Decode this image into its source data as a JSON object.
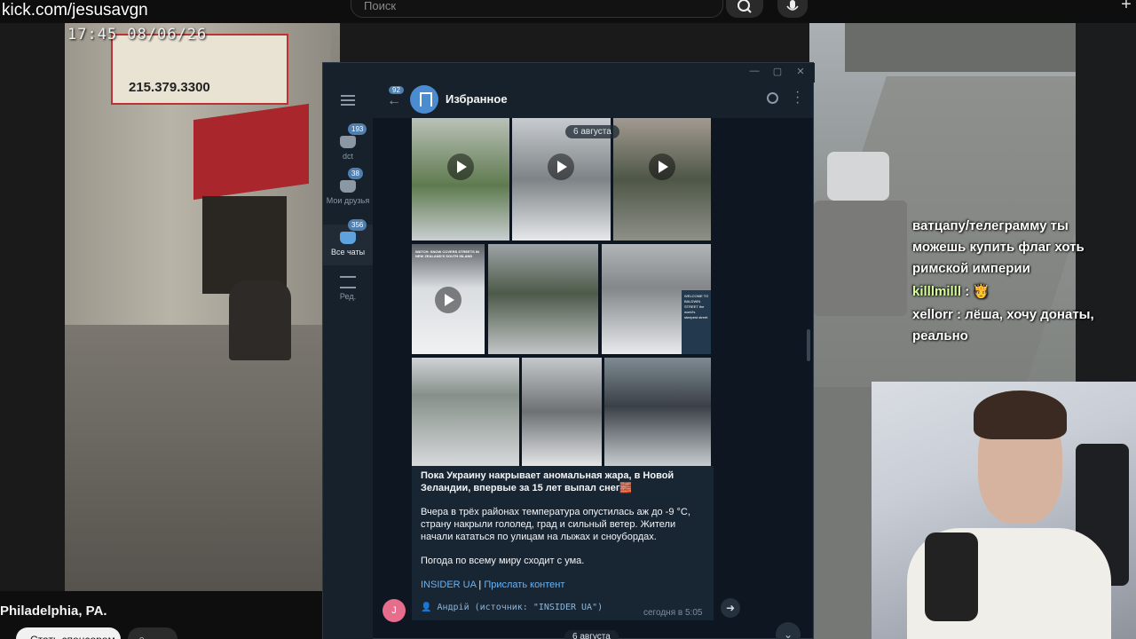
{
  "overlay": {
    "url": "kick.com/jesusavgn",
    "timestamp": "17:45 08/06/26",
    "search_placeholder": "Поиск",
    "place": "Philadelphia, PA.",
    "bottom_button": "Стать спонсором"
  },
  "left_scene": {
    "sign_phone": "215.379.3300"
  },
  "chat": [
    {
      "name": "",
      "text": "ватцапу/телеграмму ты можешь купить флаг хоть римской империи"
    },
    {
      "name": "killlmilll",
      "text": "🫅"
    },
    {
      "name": "xellorr",
      "text": "лёша, хочу донаты, реально"
    }
  ],
  "telegram": {
    "title": "Избранное",
    "back_badge": "92",
    "folders": [
      {
        "label": "dct",
        "badge": "193"
      },
      {
        "label": "Мои друзья",
        "badge": "38"
      },
      {
        "label": "Все чаты",
        "badge": "356"
      },
      {
        "label": "Ред.",
        "badge": ""
      }
    ],
    "date_label": "6 августа",
    "tile_caption": "WATCH: SNOW COVERS STREETS IN NEW ZEALAND'S SOUTH ISLAND",
    "tile_sign": "WELCOME TO BALDWIN STREET the world's steepest street",
    "message": {
      "title": "Пока Украину накрывает аномальная жара, в Новой Зеландии, впервые за 15 лет выпал снег🧱",
      "para1": "Вчера в трёх районах температура опустилась аж до -9 °C, страну накрыли гололед, град и сильный ветер. Жители начали кататься по улицам на лыжах и сноубордах.",
      "para2": "Погода по всему миру сходит с ума.",
      "link1": "INSIDER UA",
      "separator": "|",
      "link2": "Прислать контент",
      "author": "👤 Андрій (источник: \"INSIDER UA\")",
      "time": "сегодня в 5:05",
      "avatar_letter": "J"
    },
    "date_label_2": "6 августа"
  },
  "colors": {
    "telegram_bg": "#0e1621",
    "telegram_panel": "#17212b",
    "accent": "#4f7faf",
    "link": "#6ab3f3"
  }
}
